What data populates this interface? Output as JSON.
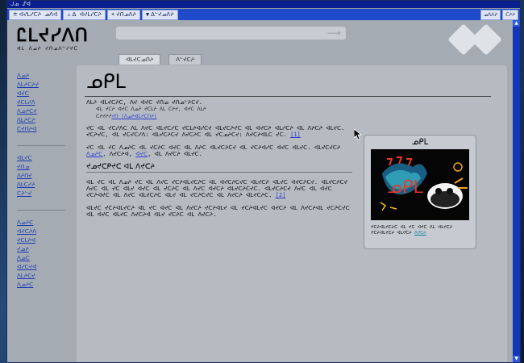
{
  "window": {
    "title": "ᒍᓄ ᔑᐊ"
  },
  "tabs": [
    {
      "label": "ᐊᔪᒪᓯᑕᔨ ᓄᐱᐊ",
      "icon": "⛤"
    },
    {
      "label": "ᐃ ᐊᔪᒪᓯᑕᔨ",
      "icon": "⚠"
    },
    {
      "label": "ᔪᑎᓄᐱᔨ",
      "icon": "☀"
    },
    {
      "label": "ᐃᓪᔪᓄᐱᔨ",
      "icon": "▼"
    }
  ],
  "tab_controls": [
    "ᓄᐱᐱᔨ",
    "ᑕᔨᔨ"
  ],
  "site": {
    "logo": "Ꮭᒪᔪᓯᐱᑎ",
    "tagline": "ᐊᒪ ᐱᓄᔨ ᔪᑎᓄᐱᓪᓯᔪᑕ"
  },
  "page_tabs": [
    "ᐊᒪᔪᑕᓄᑎᔨ",
    "ᐱᓪᔪᑕᔨ"
  ],
  "sidebar": {
    "group1": [
      "ᐱᓄᔨ",
      "ᐱᒪᔨᑕᔨᔪ",
      "ᐊᔪᑕ",
      "ᔪᑕᒪᓯᐱ",
      "ᐱᓄᔨᑕᔪ",
      "ᐱᒪᔨᑕᔨ",
      "ᑕᔪᑎᔨᐊ"
    ],
    "group2": [
      "ᐊᒪᔪᑕ",
      "ᔪᑎᓄ",
      "ᐱᔨᑎᔪ",
      "ᐱᒪᑕᓯᔨ",
      "ᑕᔨᓪᔪ"
    ],
    "group3": [
      "ᐱᓄᔨᑕ",
      "ᐊᔪᑕᔨᐱ",
      "ᔪᑕᒪᔨᐊ",
      "ᔪᓄᔨ",
      "ᐱᓄᑕ",
      "ᐊᓯᑕᔪᐊ",
      "ᐱᒪᔨᑕᔪ",
      "ᐱᓄᔨᑕ"
    ]
  },
  "page": {
    "title": "ᓄᑭᒪ"
  },
  "body": {
    "intro": "ᐱᒪᔨ ᐊᒪᔪᑕᔨᑕ, ᐱᔪ ᐊᔪᑕ ᔪᑎᓄ ᔪᑎᓄᓪᔨᑕᔪ.",
    "sub1": "ᐊᒪ ᔪᑕᔨ ᐊᔪᑕ ᐱᓄᔨ ᔪᑕᒪᔨ ᐱᒪ ᑕᔨᔪ, ᐊᔪᑕ ᐱᒪᔨ",
    "sub2": "ᑕᔨᔪᔨᔪ",
    "sub2link": "ᔪᑎ (ᐱᓄᔨᐊᒪᔪᑕᑎᔨ)",
    "p1": "ᔪᑕ ᐊᒪ ᔪᑕᓯᐱᑕ ᐱᒪ ᐱᔪᑕ ᐊᒪᔪᑕᓯᑕ ᔪᑕᒪᔨᐊᓯᑕᔪ ᐊᒪᔪᑕᔨᔪᑕ ᐊᒪ ᐊᔪᑕᔨ ᐊᒪᓯᑕᔨ ᐊᒪ ᐱᔨᑕᔨ ᐊᒪᔪᑕ. ᔪᑕᔨᔪᑕ, ᐊᒪ ᔪᑕᔪᑕᓯᐱ: ᐊᒪᔪᑕᔨᑕᔪ ᐱᔪᑕᔨᑕ ᐊᒪ ᔪᑕᓄᔨᑕᔪ: ᐱᔪᑕᔨᐊᒪᑕ ᔪᑕ.",
    "cite1": "[1]",
    "p2": "ᔪᑕ ᐊᒪ ᔪᑕ ᐱᓄᔨᑕ ᐊᒪ ᔪᑕᔨᑕ ᐊᔪᑕ ᐊᒪ ᐱᔨᑕ ᐊᒪᔪᑕᔨᑕᔪ ᐊᒪ ᔪᑕᔨᐊᓯᑕ ᐊᔪᑕ ᐊᒪᔪᑕ.",
    "p2b": "ᐊᒪᔪᑕᔪᑕᔨ",
    "p2link1": "ᐱᓄᔨᑕ",
    "p2mid": ", ᐱᔪᑕᔨᐊ,",
    "p2link2": "ᐊᔪᑕ",
    "p2end": ", ᐊᒪ ᐱᔪᑕᔨ ᐊᒪᔪᑕ.",
    "sec1": "ᔪᓄᔪᑕᑭᔪᑕ ᐊᒪ ᐱᔪᑕᔨ",
    "p3": "ᐊᒪ ᔪᑕ ᐊᒪ ᐱᓄᔨ ᔪᑕ ᐊᒪ ᐱᔪᑕ ᔪᑕᔨᐊᒪᔪᑕᔨᑕ ᐊᒪ ᐊᔪᑕᔨᑕᔪᑕ ᐊᒪᔪᑕᔨ ᐊᒪᔪᑕ ᐊᔪᑕᔨᑕᔪ. ᐊᒪᔪᑕᔨᑕᔪ ᐱᔪᑕ ᐊᒪ ᔪᑕ ᐊᒪᔪ ᐊᔪᑕ ᐊᒪ ᔪᑕᔨᑕ ᐊᒪ ᐱᔪᑕ ᐊᔪᑕᔨ ᐊᒪᔪᑕᔨᑕᔪᑕ. ᐊᒪᔪᑕᔨᑕᔪ ᐱᔪᑕ ᐊᒪ ᐊᔪᑕ ᔪᑕᔨᐊᔪᑕ ᐊᒪ ᐱᔪᑕ ᐊᒪᔪᑕᔨᑕ ᐊᒪᔪ ᐊᒪ ᔪᑕᔨᑕᔪᑕ ᐊᒪ ᐱᔪᑕᔨ ᐊᒪᔪᑕᔨᑕ.",
    "cite2": "[2]",
    "p4": "ᐊᒪᔪᑕ ᔪᑕᔨᐊᒪᔪᑕᔨ ᐊᒪ ᔪᑕ ᐊᔪᑕ ᐊᒪ ᐱᔪᑕᔨ ᔪᑕᔨᐊᒪᔪ ᐊᒪ ᔪᑕᔨᐊᒪᔪᑕ ᐊᔪᑕᔨ ᐊᒪ ᐱᔪᑕᔨᐊᒪ ᔪᑕᔨᑕᔪᑕ ᐊᒪ ᐊᔪᑕ ᐊᒪᔪᑕ ᐱᔪᑕᔨᐊ ᐊᒪᔪ ᔪᑕᔨᑕ ᐊᒪ ᐱᔪᑕᔨ."
  },
  "infobox": {
    "title": "ᓄᑭᒪ",
    "caption": "ᔪᑕᔨᐊᒪᔪᑕᔨᑕ ᐊᒪ ᔪᑕ ᐊᔪᑕ ᐱᒪ ᐊᒪᔪᑕᔨ ᔪᑕᔨᐊᒪᔪᑕᔨ ᐊᒪᔪᑕᔨ",
    "captionlink": "ᐱᔪᑕᔨ"
  },
  "colors": {
    "titlebar": "#0a1f8f",
    "tabbar": "#1f4ac9",
    "link": "#1438b8",
    "page_bg": "#a4abb2"
  },
  "icons": [
    "search-arrow-icon",
    "cursor-icon"
  ]
}
